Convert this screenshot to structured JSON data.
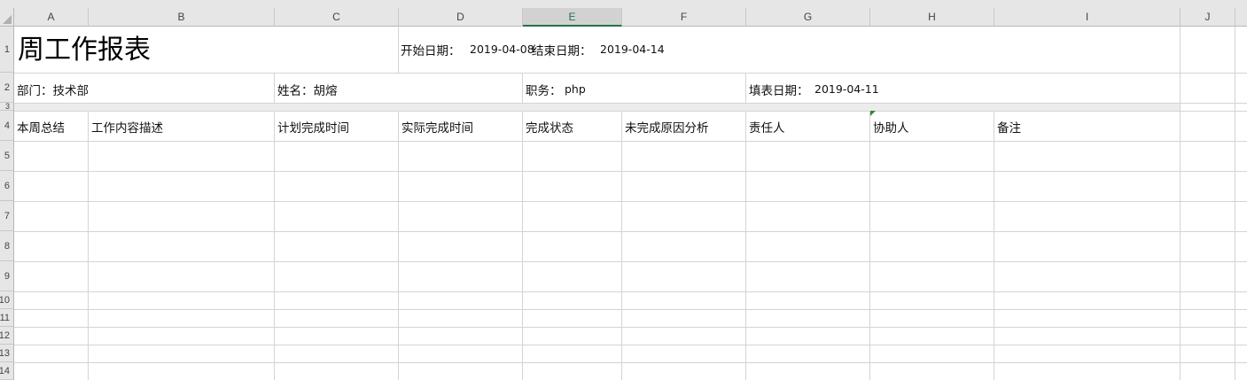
{
  "columns": [
    "A",
    "B",
    "C",
    "D",
    "E",
    "F",
    "G",
    "H",
    "I",
    "J"
  ],
  "rows": [
    "1",
    "2",
    "3",
    "4",
    "5",
    "6",
    "7",
    "8",
    "9",
    "10",
    "11",
    "12",
    "13",
    "14"
  ],
  "cells": {
    "title": "周工作报表",
    "start_label": "开始日期：",
    "start_value": "2019-04-08",
    "end_label": "结束日期：",
    "end_value": "2019-04-14",
    "dept": "部门：技术部",
    "name": "姓名：胡熔",
    "position_label": "职务：",
    "position_value": "php",
    "fill_label": "填表日期：",
    "fill_value": "2019-04-11",
    "headers": [
      "本周总结",
      "工作内容描述",
      "计划完成时间",
      "实际完成时间",
      "完成状态",
      "未完成原因分析",
      "责任人",
      "协助人",
      "备注"
    ]
  },
  "colors": {
    "selected_column_accent": "#217346"
  }
}
